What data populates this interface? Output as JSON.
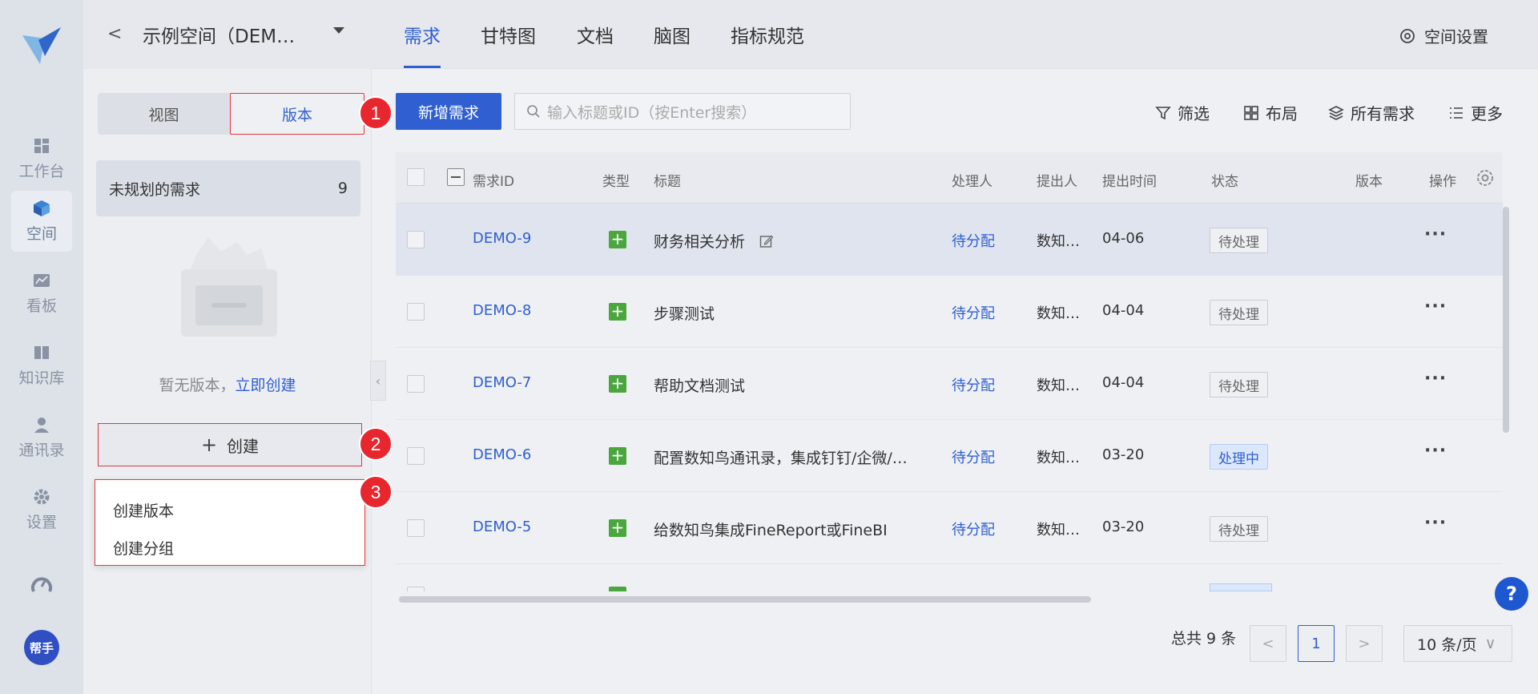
{
  "rail": {
    "items": [
      {
        "label": "工作台",
        "icon": "grid-icon"
      },
      {
        "label": "空间",
        "icon": "cube-icon"
      },
      {
        "label": "看板",
        "icon": "chart-icon"
      },
      {
        "label": "知识库",
        "icon": "book-icon"
      },
      {
        "label": "通讯录",
        "icon": "contacts-icon"
      },
      {
        "label": "设置",
        "icon": "gear-icon"
      }
    ],
    "avatar_label": "帮手"
  },
  "space": {
    "name": "示例空间（DEM…"
  },
  "panel": {
    "seg_view": "视图",
    "seg_version": "版本",
    "unplanned_label": "未规划的需求",
    "unplanned_count": "9",
    "empty_text": "暂无版本，",
    "empty_link": "立即创建",
    "create_label": "创建",
    "dropdown": [
      "创建版本",
      "创建分组"
    ]
  },
  "badges": [
    "1",
    "2",
    "3"
  ],
  "tabs": [
    "需求",
    "甘特图",
    "文档",
    "脑图",
    "指标规范"
  ],
  "settings_label": "空间设置",
  "toolbar": {
    "new_label": "新增需求",
    "search_placeholder": "输入标题或ID（按Enter搜索）",
    "filter_label": "筛选",
    "layout_label": "布局",
    "all_label": "所有需求",
    "more_label": "更多"
  },
  "table": {
    "headers": {
      "id": "需求ID",
      "type": "类型",
      "title": "标题",
      "assignee": "处理人",
      "proposer": "提出人",
      "time": "提出时间",
      "status": "状态",
      "version": "版本",
      "ops": "操作"
    },
    "rows": [
      {
        "id": "DEMO-9",
        "title": "财务相关分析",
        "assignee": "待分配",
        "proposer": "数知…",
        "time": "04-06",
        "status": "待处理"
      },
      {
        "id": "DEMO-8",
        "title": "步骤测试",
        "assignee": "待分配",
        "proposer": "数知…",
        "time": "04-04",
        "status": "待处理"
      },
      {
        "id": "DEMO-7",
        "title": "帮助文档测试",
        "assignee": "待分配",
        "proposer": "数知…",
        "time": "04-04",
        "status": "待处理"
      },
      {
        "id": "DEMO-6",
        "title": "配置数知鸟通讯录，集成钉钉/企微/…",
        "assignee": "待分配",
        "proposer": "数知…",
        "time": "03-20",
        "status": "处理中"
      },
      {
        "id": "DEMO-5",
        "title": "给数知鸟集成FineReport或FineBI",
        "assignee": "待分配",
        "proposer": "数知…",
        "time": "03-20",
        "status": "待处理"
      }
    ]
  },
  "pager": {
    "total": "总共 9 条",
    "current": "1",
    "size": "10 条/页"
  },
  "help_label": "?",
  "colors": {
    "accent": "#2f5fd0",
    "annotation": "#e0393e",
    "type_green": "#4aa63d"
  }
}
